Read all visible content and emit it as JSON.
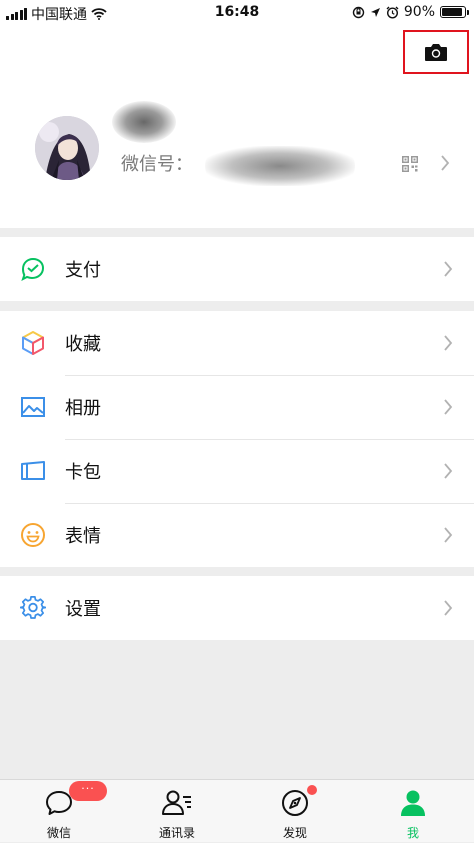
{
  "status_bar": {
    "carrier": "中国联通",
    "time": "16:48",
    "battery": "90%",
    "battery_level": 0.9
  },
  "header": {
    "camera_icon": "camera-icon",
    "wxid_label": "微信号："
  },
  "menu": {
    "pay": {
      "label": "支付",
      "icon": "pay-icon"
    },
    "favorites": {
      "label": "收藏",
      "icon": "cube-icon"
    },
    "album": {
      "label": "相册",
      "icon": "album-icon"
    },
    "cards": {
      "label": "卡包",
      "icon": "card-icon"
    },
    "stickers": {
      "label": "表情",
      "icon": "smile-icon"
    },
    "settings": {
      "label": "设置",
      "icon": "gear-icon"
    }
  },
  "tabbar": {
    "tabs": [
      {
        "label": "微信",
        "icon": "chat-icon"
      },
      {
        "label": "通讯录",
        "icon": "contacts-icon"
      },
      {
        "label": "发现",
        "icon": "compass-icon"
      },
      {
        "label": "我",
        "icon": "person-icon"
      }
    ],
    "chat_badge": "···"
  },
  "colors": {
    "accent_green": "#07c160",
    "badge_red": "#fa5151",
    "highlight_red": "#e0141e"
  }
}
